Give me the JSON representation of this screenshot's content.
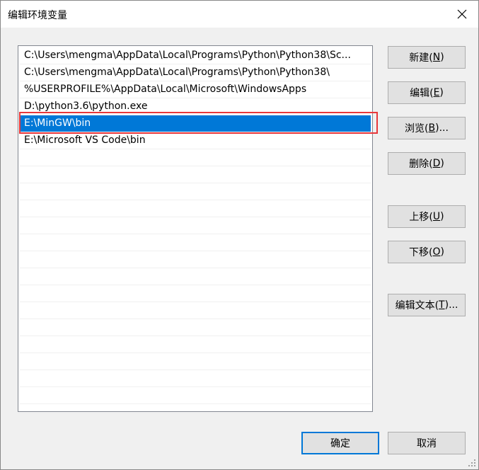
{
  "window": {
    "title": "编辑环境变量",
    "close_icon": "close-icon"
  },
  "list": {
    "items": [
      "C:\\Users\\mengma\\AppData\\Local\\Programs\\Python\\Python38\\Sc...",
      "C:\\Users\\mengma\\AppData\\Local\\Programs\\Python\\Python38\\",
      "%USERPROFILE%\\AppData\\Local\\Microsoft\\WindowsApps",
      "D:\\python3.6\\python.exe",
      "E:\\MinGW\\bin",
      "E:\\Microsoft VS Code\\bin"
    ],
    "selected_index": 4,
    "selection_color": "#0078d7",
    "highlight_color": "#e8383b"
  },
  "buttons": {
    "new": {
      "label": "新建(",
      "key": "N",
      "suffix": ")"
    },
    "edit": {
      "label": "编辑(",
      "key": "E",
      "suffix": ")"
    },
    "browse": {
      "label": "浏览(",
      "key": "B",
      "suffix": ")..."
    },
    "delete": {
      "label": "删除(",
      "key": "D",
      "suffix": ")"
    },
    "move_up": {
      "label": "上移(",
      "key": "U",
      "suffix": ")"
    },
    "move_down": {
      "label": "下移(",
      "key": "O",
      "suffix": ")"
    },
    "edit_text": {
      "label": "编辑文本(",
      "key": "T",
      "suffix": ")..."
    },
    "ok": "确定",
    "cancel": "取消"
  }
}
